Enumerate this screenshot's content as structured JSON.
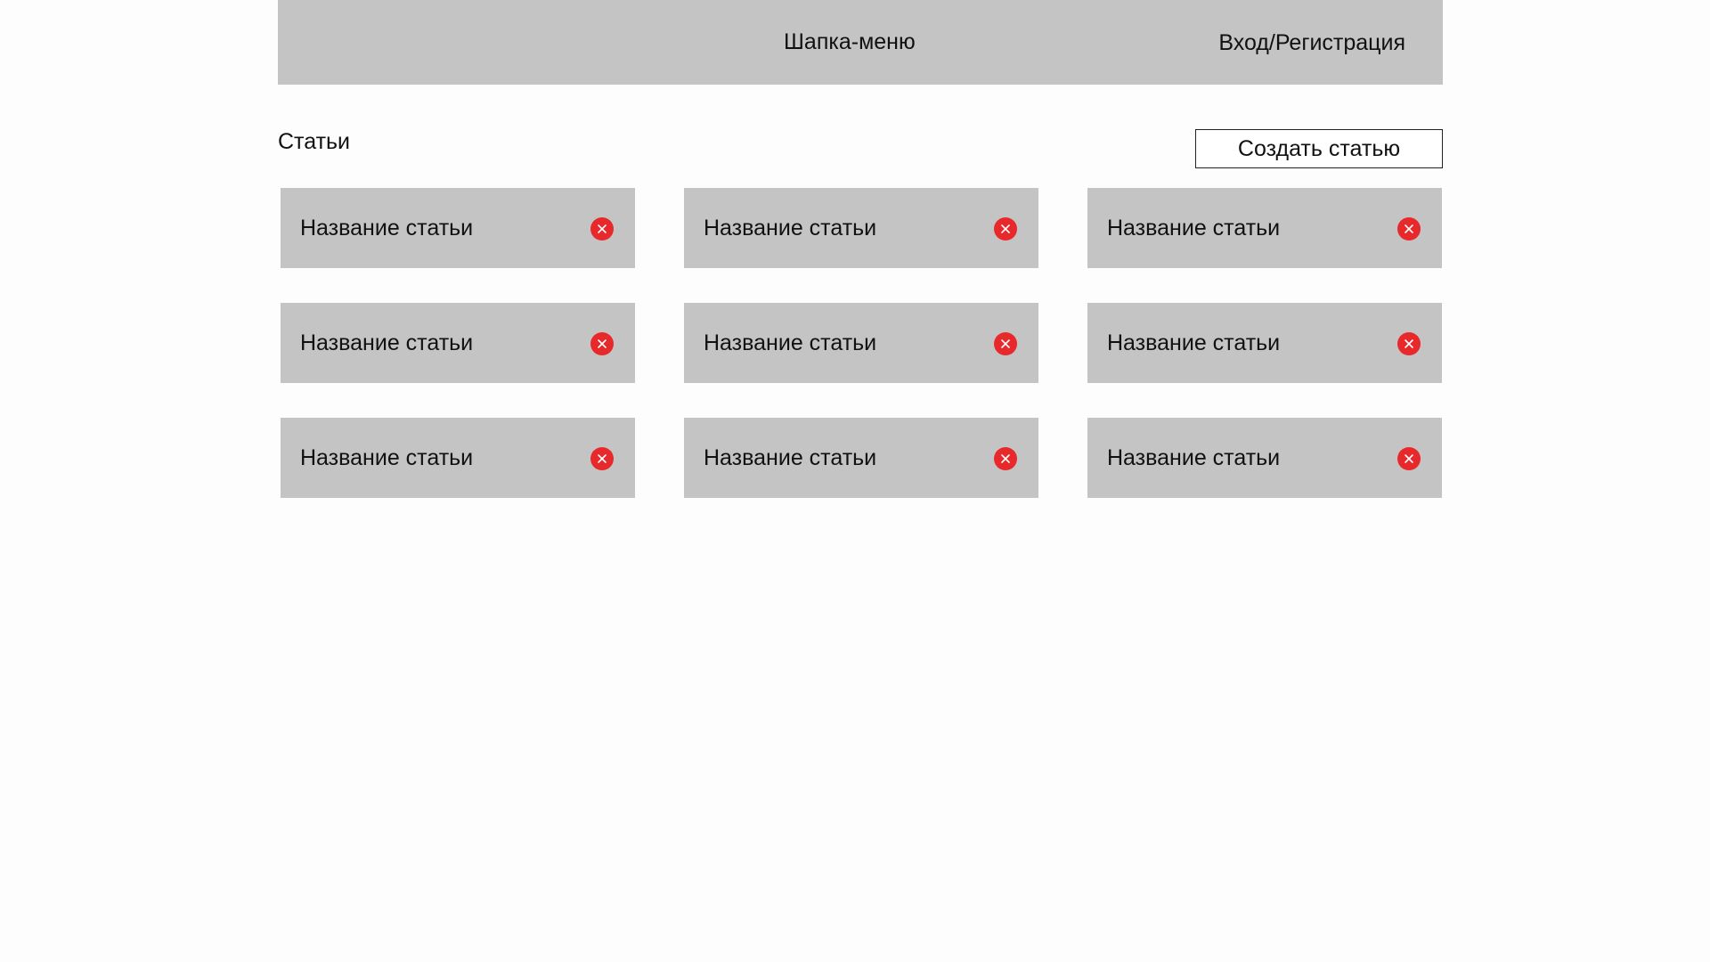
{
  "header": {
    "menu_label": "Шапка-меню",
    "auth_label": "Вход/Регистрация"
  },
  "section": {
    "title": "Статьи"
  },
  "create_button": {
    "label": "Создать статью"
  },
  "articles": [
    {
      "title": "Название статьи",
      "delete_icon": "close-circle-icon"
    },
    {
      "title": "Название статьи",
      "delete_icon": "close-circle-icon"
    },
    {
      "title": "Название статьи",
      "delete_icon": "close-circle-icon"
    },
    {
      "title": "Название статьи",
      "delete_icon": "close-circle-icon"
    },
    {
      "title": "Название статьи",
      "delete_icon": "close-circle-icon"
    },
    {
      "title": "Название статьи",
      "delete_icon": "close-circle-icon"
    },
    {
      "title": "Название статьи",
      "delete_icon": "close-circle-icon"
    },
    {
      "title": "Название статьи",
      "delete_icon": "close-circle-icon"
    },
    {
      "title": "Название статьи",
      "delete_icon": "close-circle-icon"
    }
  ],
  "colors": {
    "placeholder_gray": "#c4c4c4",
    "delete_red": "#e8292c",
    "background": "#fdfdfd",
    "text": "#111111"
  }
}
